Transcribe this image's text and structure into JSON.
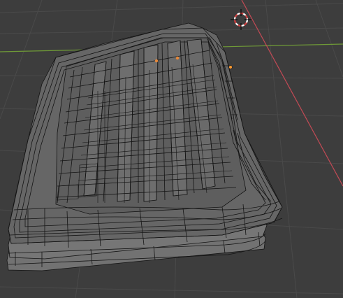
{
  "viewport": {
    "mode": "wireframe",
    "background_color": "#3d3d3d",
    "grid_color": "#4a4a4a",
    "x_axis_color": "#c34a55",
    "y_axis_color": "#6f9a37",
    "object_fill": "#6a6a6a",
    "object_wire_color": "#141414",
    "cursor_icon": "3d-cursor-icon",
    "origin_icon": "object-origin-icon",
    "origin_color": "#ff9a30",
    "selected_vertex_color": "#e8893a"
  }
}
